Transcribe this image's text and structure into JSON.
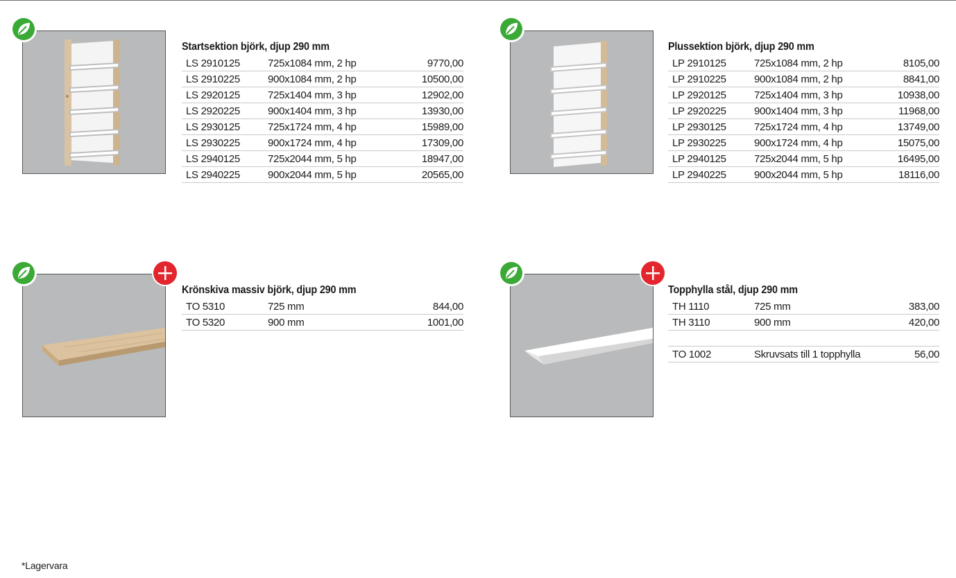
{
  "sections": [
    {
      "title": "Startsektion björk, djup 290 mm",
      "rows": [
        {
          "code": "LS 2910125",
          "desc": "725x1084 mm, 2 hp",
          "price": "9770,00"
        },
        {
          "code": "LS 2910225",
          "desc": "900x1084 mm, 2 hp",
          "price": "10500,00"
        },
        {
          "code": "LS 2920125",
          "desc": "725x1404 mm, 3 hp",
          "price": "12902,00"
        },
        {
          "code": "LS 2920225",
          "desc": "900x1404 mm, 3 hp",
          "price": "13930,00"
        },
        {
          "code": "LS 2930125",
          "desc": "725x1724 mm, 4 hp",
          "price": "15989,00"
        },
        {
          "code": "LS 2930225",
          "desc": "900x1724 mm, 4 hp",
          "price": "17309,00"
        },
        {
          "code": "LS 2940125",
          "desc": "725x2044 mm, 5 hp",
          "price": "18947,00"
        },
        {
          "code": "LS 2940225",
          "desc": "900x2044 mm, 5 hp",
          "price": "20565,00"
        }
      ]
    },
    {
      "title": "Plussektion björk, djup 290 mm",
      "rows": [
        {
          "code": "LP 2910125",
          "desc": "725x1084 mm, 2 hp",
          "price": "8105,00"
        },
        {
          "code": "LP 2910225",
          "desc": "900x1084 mm, 2 hp",
          "price": "8841,00"
        },
        {
          "code": "LP 2920125",
          "desc": "725x1404 mm, 3 hp",
          "price": "10938,00"
        },
        {
          "code": "LP 2920225",
          "desc": "900x1404 mm, 3 hp",
          "price": "11968,00"
        },
        {
          "code": "LP 2930125",
          "desc": "725x1724 mm, 4 hp",
          "price": "13749,00"
        },
        {
          "code": "LP 2930225",
          "desc": "900x1724 mm, 4 hp",
          "price": "15075,00"
        },
        {
          "code": "LP 2940125",
          "desc": "725x2044 mm, 5 hp",
          "price": "16495,00"
        },
        {
          "code": "LP 2940225",
          "desc": "900x2044 mm, 5 hp",
          "price": "18116,00"
        }
      ]
    },
    {
      "title": "Krönskiva massiv björk, djup 290 mm",
      "rows": [
        {
          "code": "TO 5310",
          "desc": "725 mm",
          "price": "844,00"
        },
        {
          "code": "TO 5320",
          "desc": "900 mm",
          "price": "1001,00"
        }
      ]
    },
    {
      "title": "Topphylla stål, djup 290 mm",
      "rows": [
        {
          "code": "TH 1110",
          "desc": "725 mm",
          "price": "383,00"
        },
        {
          "code": "TH 3110",
          "desc": "900 mm",
          "price": "420,00"
        },
        {
          "code": "TO 1002",
          "desc": "Skruvsats till 1 topphylla",
          "price": "56,00"
        }
      ]
    }
  ],
  "icons": {
    "eco_badge": "leaf-icon",
    "plus_badge": "plus-icon"
  },
  "colors": {
    "eco_green": "#3aa935",
    "plus_red": "#e3262d",
    "photo_bg": "#b9babb"
  },
  "footnote": "*Lagervara"
}
